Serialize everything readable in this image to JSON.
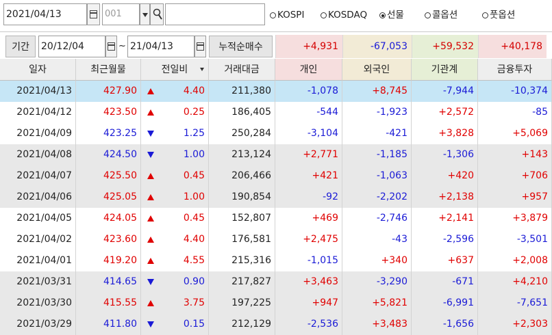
{
  "toolbar": {
    "date": "2021/04/13",
    "code": "001",
    "name_value": "",
    "radios": [
      {
        "label": "KOSPI",
        "selected": false
      },
      {
        "label": "KOSDAQ",
        "selected": false
      },
      {
        "label": "선물",
        "selected": true
      },
      {
        "label": "콜옵션",
        "selected": false
      },
      {
        "label": "풋옵션",
        "selected": false
      }
    ]
  },
  "period": {
    "label": "기간",
    "from": "20/12/04",
    "separator": "~",
    "to": "21/04/13",
    "cum_label": "누적순매수",
    "sums": [
      "+4,931",
      "-67,053",
      "+59,532",
      "+40,178"
    ]
  },
  "colors": {
    "sum_bg": [
      "#f6dede",
      "#f2ebd6",
      "#e6efd6",
      "#f6dede"
    ],
    "header_bg": [
      "#eeeeee",
      "#eeeeee",
      "#eeeeee",
      "#eeeeee",
      "#f6dede",
      "#f2ebd6",
      "#e6efd6",
      "#eeeeee"
    ],
    "selected_row": "#c6e6f6",
    "shaded_row": "#e8e8e8",
    "up": "#e00000",
    "down": "#1a1ad6"
  },
  "table": {
    "headers": [
      "일자",
      "최근월물",
      "전일비",
      "거래대금",
      "개인",
      "외국인",
      "기관계",
      "금융투자"
    ],
    "rows": [
      {
        "date": "2021/04/13",
        "price": "427.90",
        "dir": "up",
        "chg": "4.40",
        "vol": "211,380",
        "ind": "-1,078",
        "for": "+8,745",
        "inst": "-7,944",
        "fin": "-10,374"
      },
      {
        "date": "2021/04/12",
        "price": "423.50",
        "dir": "up",
        "chg": "0.25",
        "vol": "186,405",
        "ind": "-544",
        "for": "-1,923",
        "inst": "+2,572",
        "fin": "-85"
      },
      {
        "date": "2021/04/09",
        "price": "423.25",
        "dir": "down",
        "chg": "1.25",
        "vol": "250,284",
        "ind": "-3,104",
        "for": "-421",
        "inst": "+3,828",
        "fin": "+5,069"
      },
      {
        "date": "2021/04/08",
        "price": "424.50",
        "dir": "down",
        "chg": "1.00",
        "vol": "213,124",
        "ind": "+2,771",
        "for": "-1,185",
        "inst": "-1,306",
        "fin": "+143"
      },
      {
        "date": "2021/04/07",
        "price": "425.50",
        "dir": "up",
        "chg": "0.45",
        "vol": "206,466",
        "ind": "+421",
        "for": "-1,063",
        "inst": "+420",
        "fin": "+706"
      },
      {
        "date": "2021/04/06",
        "price": "425.05",
        "dir": "up",
        "chg": "1.00",
        "vol": "190,854",
        "ind": "-92",
        "for": "-2,202",
        "inst": "+2,138",
        "fin": "+957"
      },
      {
        "date": "2021/04/05",
        "price": "424.05",
        "dir": "up",
        "chg": "0.45",
        "vol": "152,807",
        "ind": "+469",
        "for": "-2,746",
        "inst": "+2,141",
        "fin": "+3,879"
      },
      {
        "date": "2021/04/02",
        "price": "423.60",
        "dir": "up",
        "chg": "4.40",
        "vol": "176,581",
        "ind": "+2,475",
        "for": "-43",
        "inst": "-2,596",
        "fin": "-3,501"
      },
      {
        "date": "2021/04/01",
        "price": "419.20",
        "dir": "up",
        "chg": "4.55",
        "vol": "215,316",
        "ind": "-1,015",
        "for": "+340",
        "inst": "+637",
        "fin": "+2,008"
      },
      {
        "date": "2021/03/31",
        "price": "414.65",
        "dir": "down",
        "chg": "0.90",
        "vol": "217,827",
        "ind": "+3,463",
        "for": "-3,290",
        "inst": "-671",
        "fin": "+4,210"
      },
      {
        "date": "2021/03/30",
        "price": "415.55",
        "dir": "up",
        "chg": "3.75",
        "vol": "197,225",
        "ind": "+947",
        "for": "+5,821",
        "inst": "-6,991",
        "fin": "-7,651"
      },
      {
        "date": "2021/03/29",
        "price": "411.80",
        "dir": "down",
        "chg": "0.15",
        "vol": "212,129",
        "ind": "-2,536",
        "for": "+3,483",
        "inst": "-1,656",
        "fin": "+2,303"
      }
    ],
    "row_shading": [
      "selected",
      "white",
      "white",
      "shaded",
      "shaded",
      "shaded",
      "white",
      "white",
      "white",
      "shaded",
      "shaded",
      "shaded"
    ]
  }
}
